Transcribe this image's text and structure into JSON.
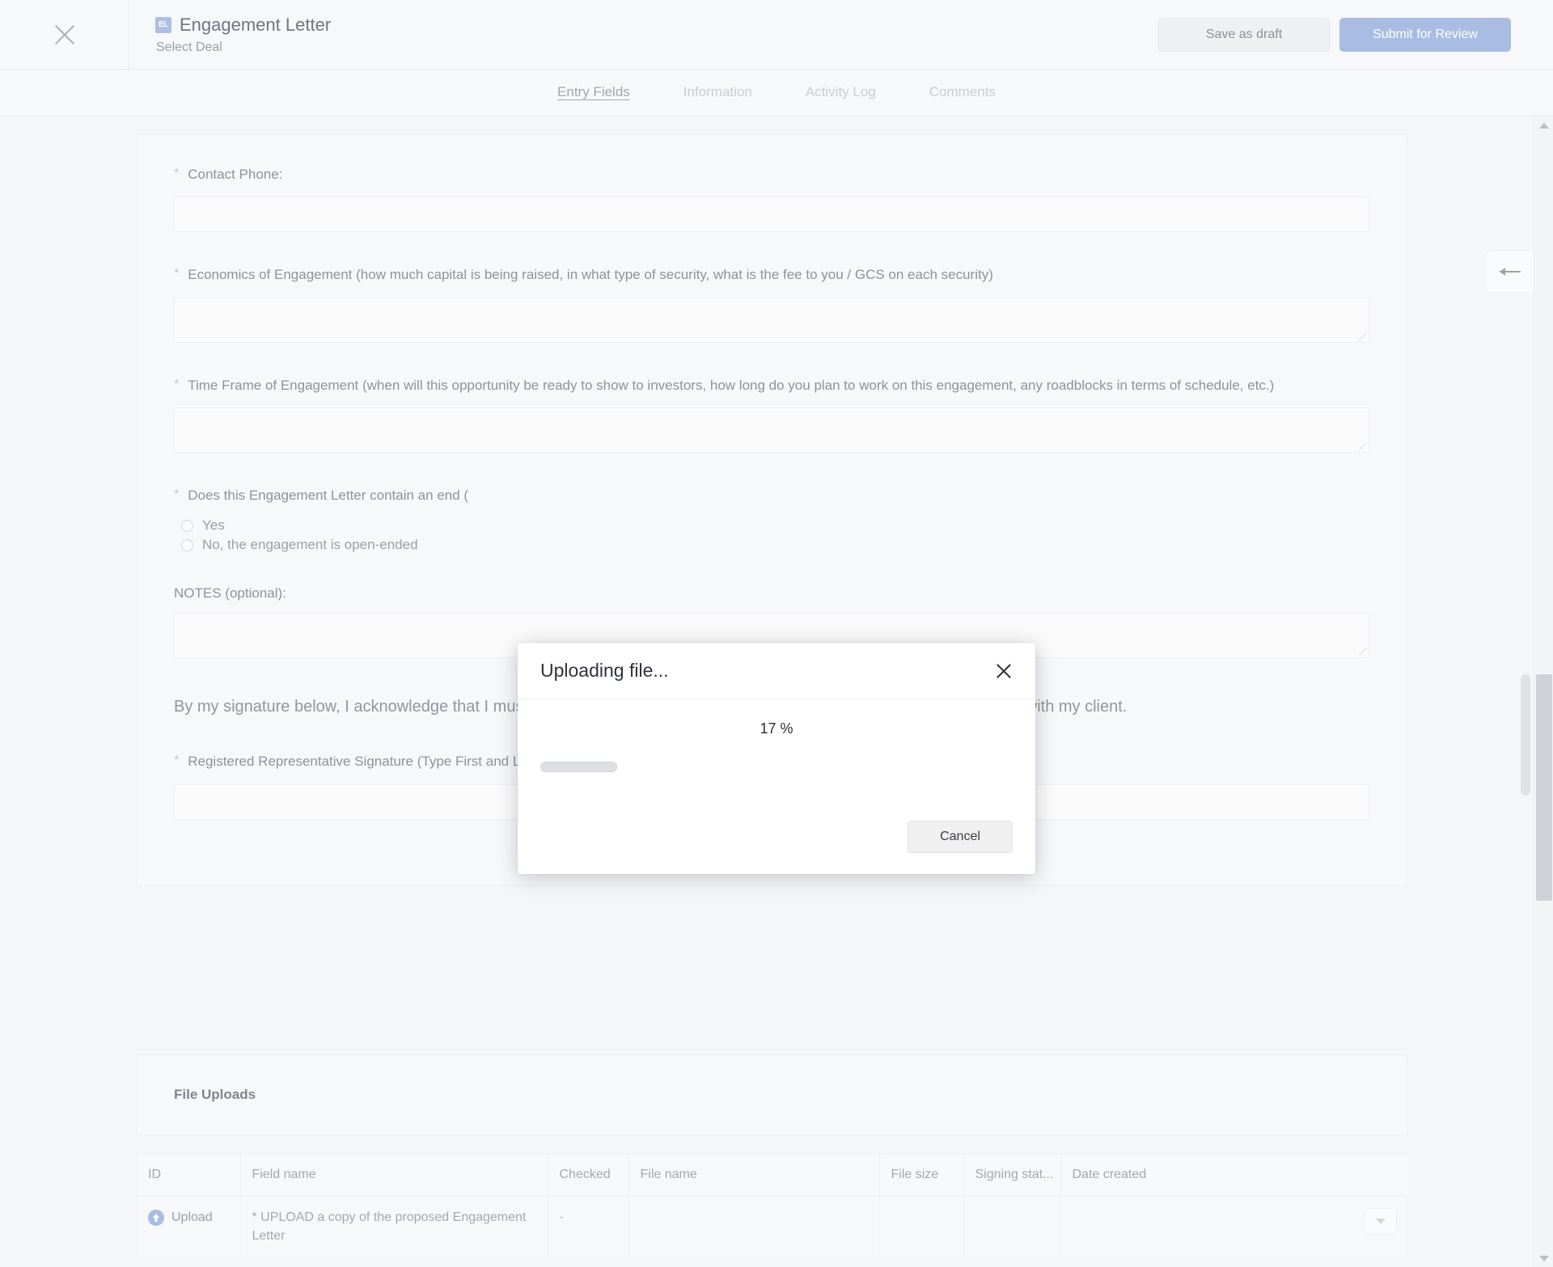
{
  "header": {
    "close_icon": "close-icon",
    "badge": "EL",
    "title": "Engagement Letter",
    "subtitle": "Select Deal",
    "save_draft_label": "Save as draft",
    "submit_label": "Submit for Review",
    "accent_color": "#a9bde3"
  },
  "tabs": [
    {
      "label": "Entry Fields",
      "active": true
    },
    {
      "label": "Information",
      "active": false
    },
    {
      "label": "Activity Log",
      "active": false
    },
    {
      "label": "Comments",
      "active": false
    }
  ],
  "form": {
    "required_marker": "*",
    "fields": [
      {
        "label": "Contact Phone:",
        "type": "input",
        "value": "",
        "required": true
      },
      {
        "label": "Economics of Engagement (how much capital is being raised, in what type of security, what is the fee to you / GCS on each security)",
        "type": "textarea",
        "value": "",
        "required": true
      },
      {
        "label": "Time Frame of Engagement (when will this opportunity be ready to show to investors, how long do you plan to work on this engagement, any roadblocks in terms of schedule, etc.)",
        "type": "textarea",
        "value": "",
        "required": true
      },
      {
        "label": "Does this Engagement Letter contain an end (",
        "type": "radio",
        "required": true,
        "options": [
          "Yes",
          "No, the engagement is open-ended"
        ],
        "selected": ""
      },
      {
        "label": "NOTES (optional):",
        "type": "textarea",
        "value": "",
        "required": false
      }
    ],
    "acknowledgement": "By my signature below, I acknowledge that I must receive approval from GCS prior to executing this engagement letter with my client.",
    "signature_field": {
      "label": "Registered Representative Signature (Type First and Last Name)",
      "value": "",
      "required": true
    }
  },
  "uploads_section": {
    "title": "File Uploads",
    "columns": [
      "ID",
      "Field name",
      "Checked",
      "File name",
      "File size",
      "Signing stat...",
      "Date created"
    ],
    "rows": [
      {
        "id": "Upload",
        "id_icon": "upload-circle-icon",
        "field_name": "*  UPLOAD a copy of the proposed Engagement Letter",
        "checked": "-",
        "file_name": "",
        "file_size": "",
        "signing_status": "",
        "date_created": "",
        "row_menu_icon": "chevron-down-icon"
      }
    ]
  },
  "side_panel_toggle": {
    "icon": "arrow-left-icon"
  },
  "modal": {
    "title": "Uploading file...",
    "close_icon": "close-icon",
    "percent_label": "17 %",
    "percent_value": 17,
    "cancel_label": "Cancel"
  }
}
